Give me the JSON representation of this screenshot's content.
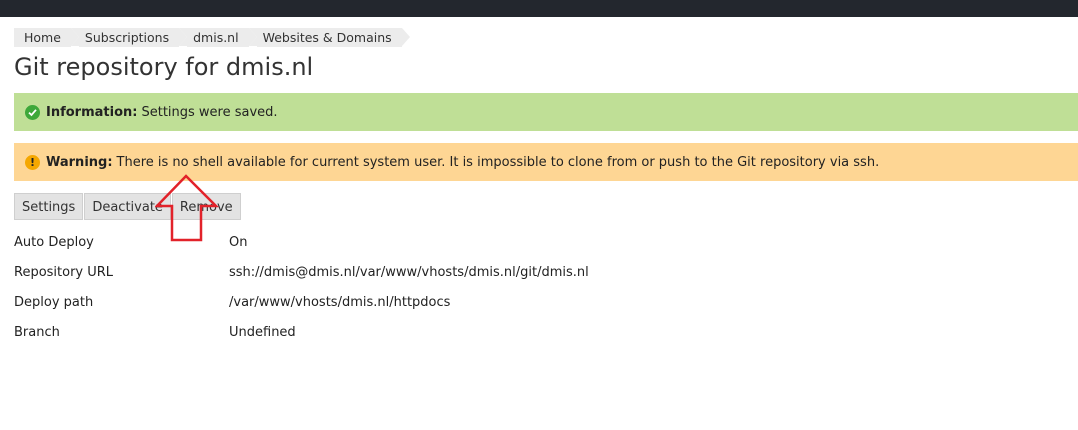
{
  "breadcrumbs": [
    "Home",
    "Subscriptions",
    "dmis.nl",
    "Websites & Domains"
  ],
  "page_title": "Git repository for dmis.nl",
  "messages": {
    "info": {
      "label": "Information:",
      "text": "Settings were saved.",
      "icon": "check-circle-icon",
      "color": "#bfdf96"
    },
    "warning": {
      "label": "Warning:",
      "text": "There is no shell available for current system user. It is impossible to clone from or push to the Git repository via ssh.",
      "icon": "exclamation-circle-icon",
      "color": "#fed694"
    }
  },
  "toolbar": {
    "settings_label": "Settings",
    "deactivate_label": "Deactivate",
    "remove_label": "Remove"
  },
  "details": [
    {
      "label": "Auto Deploy",
      "value": "On"
    },
    {
      "label": "Repository URL",
      "value": "ssh://dmis@dmis.nl/var/www/vhosts/dmis.nl/git/dmis.nl"
    },
    {
      "label": "Deploy path",
      "value": "/var/www/vhosts/dmis.nl/httpdocs"
    },
    {
      "label": "Branch",
      "value": "Undefined"
    }
  ],
  "annotation": {
    "icon": "red-up-arrow-icon",
    "color": "#e2222a"
  }
}
